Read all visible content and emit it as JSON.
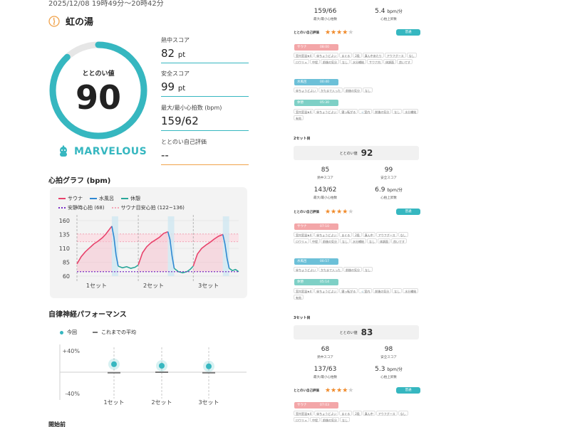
{
  "header": {
    "timestamp": "2025/12/08 19時49分～20時42分",
    "facility_name": "虹の湯"
  },
  "score": {
    "label": "ととのい値",
    "value": 90,
    "ring_fraction": 0.88,
    "grade": "MARVELOUS"
  },
  "metrics": [
    {
      "label": "熱中スコア",
      "value": "82",
      "unit": "pt"
    },
    {
      "label": "安全スコア",
      "value": "99",
      "unit": "pt"
    },
    {
      "label": "最大/最小心拍数 (bpm)",
      "value": "159/62",
      "unit": ""
    },
    {
      "label": "ととのい自己評価",
      "value": "--",
      "unit": ""
    }
  ],
  "heart_graph": {
    "title": "心拍グラフ (bpm)",
    "legend": {
      "sauna": "サウナ",
      "water": "水風呂",
      "rest": "休憩",
      "resting_hr": "安静時心拍 (68)",
      "sauna_target": "サウナ目安心拍 (122~136)"
    },
    "y_ticks": [
      "160",
      "135",
      "110",
      "85",
      "60"
    ],
    "set_labels": [
      "1セット",
      "2セット",
      "3セット"
    ]
  },
  "chart_data": {
    "type": "line",
    "ylim": [
      60,
      160
    ],
    "resting_hr": 68,
    "target_range": [
      122,
      136
    ],
    "segments": [
      {
        "phase": "sauna",
        "points": [
          [
            0,
            82
          ],
          [
            4,
            95
          ],
          [
            8,
            104
          ],
          [
            12,
            111
          ],
          [
            16,
            118
          ],
          [
            20,
            123
          ],
          [
            24,
            129
          ],
          [
            27,
            135
          ],
          [
            29,
            140
          ],
          [
            31,
            145
          ],
          [
            33,
            150
          ]
        ]
      },
      {
        "phase": "water",
        "points": [
          [
            33,
            150
          ],
          [
            35,
            130
          ],
          [
            37,
            98
          ],
          [
            39,
            78
          ]
        ]
      },
      {
        "phase": "rest",
        "points": [
          [
            39,
            78
          ],
          [
            43,
            75
          ],
          [
            47,
            77
          ],
          [
            51,
            74
          ],
          [
            55,
            76
          ],
          [
            58,
            80
          ]
        ]
      },
      {
        "phase": "sauna",
        "points": [
          [
            58,
            80
          ],
          [
            62,
            102
          ],
          [
            66,
            113
          ],
          [
            70,
            120
          ],
          [
            74,
            125
          ],
          [
            78,
            130
          ],
          [
            82,
            137
          ],
          [
            86,
            140
          ]
        ]
      },
      {
        "phase": "water",
        "points": [
          [
            86,
            140
          ],
          [
            88,
            126
          ],
          [
            90,
            96
          ],
          [
            92,
            74
          ]
        ]
      },
      {
        "phase": "rest",
        "points": [
          [
            92,
            74
          ],
          [
            96,
            68
          ],
          [
            100,
            66
          ],
          [
            104,
            68
          ],
          [
            107,
            72
          ],
          [
            110,
            78
          ]
        ]
      },
      {
        "phase": "sauna",
        "points": [
          [
            110,
            78
          ],
          [
            114,
            100
          ],
          [
            118,
            110
          ],
          [
            122,
            116
          ],
          [
            126,
            121
          ],
          [
            130,
            127
          ],
          [
            134,
            132
          ],
          [
            138,
            135
          ]
        ]
      },
      {
        "phase": "water",
        "points": [
          [
            138,
            135
          ],
          [
            140,
            118
          ],
          [
            142,
            92
          ],
          [
            144,
            74
          ]
        ]
      },
      {
        "phase": "rest",
        "points": [
          [
            144,
            74
          ],
          [
            147,
            70
          ],
          [
            150,
            72
          ],
          [
            153,
            68
          ]
        ]
      }
    ]
  },
  "ans": {
    "title": "自律神経パフォーマンス",
    "legend_current": "今回",
    "legend_average": "これまでの平均",
    "y_top": "+40%",
    "y_bottom": "-40%",
    "set_labels": [
      "1セット",
      "2セット",
      "3セット"
    ],
    "current": [
      15,
      12,
      11
    ],
    "average": [
      -1,
      0,
      -1
    ]
  },
  "next_section_title": "開始前",
  "right": {
    "top": {
      "hr_value": "159/66",
      "hr_label": "最大/最小心拍数",
      "rate_value": "5.4",
      "rate_unit": "bpm/分",
      "rate_label": "心拍上昇数",
      "rating_label": "ととのい自己評価",
      "stars": 4,
      "badge": "普通"
    },
    "set1_stages": {
      "sauna_tag": "サウナ",
      "sauna_time": "08:00",
      "sauna_chips": [
        "室内室温★4",
        "😀ちょうどよい",
        "まぐる",
        "2段",
        "真ん中あたり",
        "アウフグース",
        "なし",
        "ロウリュ",
        "中程",
        "前後の気分",
        "なし",
        "水分補給",
        "サウナ内",
        "体調面",
        "良いです"
      ],
      "water_tag": "水風呂",
      "water_time": "00:40",
      "water_chips": [
        "😀ちょうどよい",
        "かたまで入った",
        "前後の気分",
        "なし"
      ],
      "rest_tag": "休憩",
      "rest_time": "05:30",
      "rest_chips": [
        "室内室温★4",
        "😀ちょうどよい",
        "寝っ転がる",
        "🚽室内",
        "前後の気分",
        "なし",
        "水分補給",
        "有効"
      ]
    },
    "set2": {
      "heading": "2セット目",
      "totonoi_label": "ととのい値",
      "totonoi_value": "92",
      "heat_value": "85",
      "heat_label": "熱中スコア",
      "safe_value": "99",
      "safe_label": "安全スコア",
      "hr_value": "143/62",
      "hr_label": "最大/最小心拍数",
      "rate_value": "6.9",
      "rate_unit": "bpm/分",
      "rate_label": "心拍上昇数",
      "rating_label": "ととのい自己評価",
      "stars": 4,
      "badge": "普通",
      "sauna_tag": "サウナ",
      "sauna_time": "07:10",
      "sauna_chips": [
        "室内室温★4",
        "😀ちょうどよい",
        "まぐる",
        "2段",
        "真ん中",
        "アウフグース",
        "なし",
        "ロウリュ",
        "中程",
        "前後の気分",
        "なし",
        "水分補給",
        "なし",
        "体調面",
        "良いです"
      ],
      "water_tag": "水風呂",
      "water_time": "00:57",
      "water_chips": [
        "😀ちょうどよい",
        "かたまで入った",
        "前後の気分",
        "なし"
      ],
      "rest_tag": "休憩",
      "rest_time": "05:14",
      "rest_chips": [
        "室内室温★4",
        "😀ちょうどよい",
        "寝っ転がる",
        "🚽室内",
        "前後の気分",
        "なし",
        "水分補給",
        "有効"
      ]
    },
    "set3": {
      "heading": "3セット目",
      "totonoi_label": "ととのい値",
      "totonoi_value": "83",
      "heat_value": "68",
      "heat_label": "熱中スコア",
      "safe_value": "98",
      "safe_label": "安全スコア",
      "hr_value": "137/63",
      "hr_label": "最大/最小心拍数",
      "rate_value": "5.3",
      "rate_unit": "bpm/分",
      "rate_label": "心拍上昇数",
      "rating_label": "ととのい自己評価",
      "stars": 4,
      "badge": "普通",
      "sauna_tag": "サウナ",
      "sauna_time": "07:03",
      "sauna_chips": [
        "室内室温★4",
        "😀ちょうどよい",
        "まぐる",
        "2段",
        "真ん中",
        "アウフグース",
        "なし",
        "ロウリュ",
        "中程",
        "前後の気分",
        "なし"
      ]
    }
  },
  "colors": {
    "accent": "#36b7c0",
    "sauna": "#e8436c",
    "water": "#2f88d2",
    "rest": "#2aa79a",
    "resting": "#7a2ec5",
    "target": "#f4a7b8",
    "star": "#f08a2a"
  }
}
